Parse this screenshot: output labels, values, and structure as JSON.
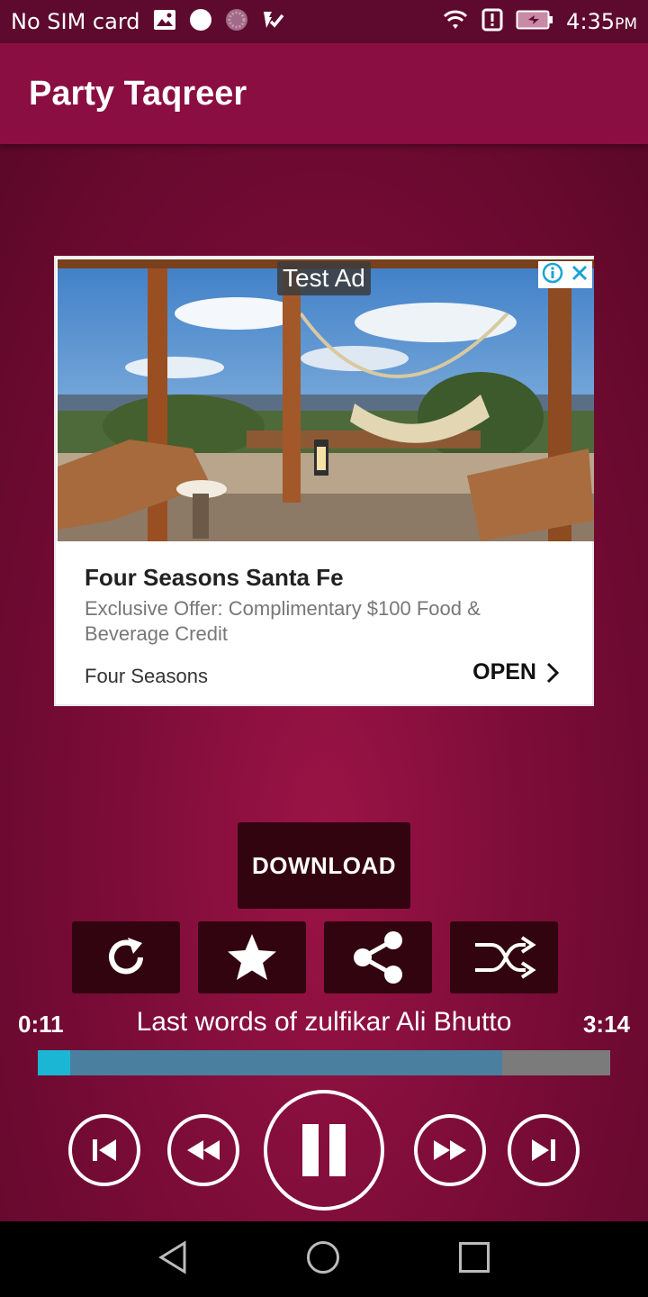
{
  "status_bar": {
    "carrier": "No SIM card",
    "time": "4:35",
    "time_suffix": "PM"
  },
  "app_bar": {
    "title": "Party Taqreer"
  },
  "ad": {
    "badge": "Test Ad",
    "title": "Four Seasons Santa Fe",
    "description": "Exclusive Offer: Complimentary $100 Food & Beverage Credit",
    "advertiser": "Four Seasons",
    "cta": "OPEN"
  },
  "actions": {
    "download_label": "DOWNLOAD",
    "icons": [
      "repeat-icon",
      "star-icon",
      "share-icon",
      "shuffle-icon"
    ]
  },
  "player": {
    "elapsed": "0:11",
    "duration": "3:14",
    "track_title": "Last words of zulfikar Ali Bhutto",
    "progress_fraction": 0.057,
    "buffered_fraction": 0.812,
    "state": "playing"
  },
  "colors": {
    "status_bar": "#5e0a2e",
    "app_bar": "#8a0e42",
    "button_dark": "#32040f",
    "progress_played": "#1ab6d4",
    "progress_buffer": "#4a7fa0",
    "progress_track": "#7b7b7b"
  }
}
